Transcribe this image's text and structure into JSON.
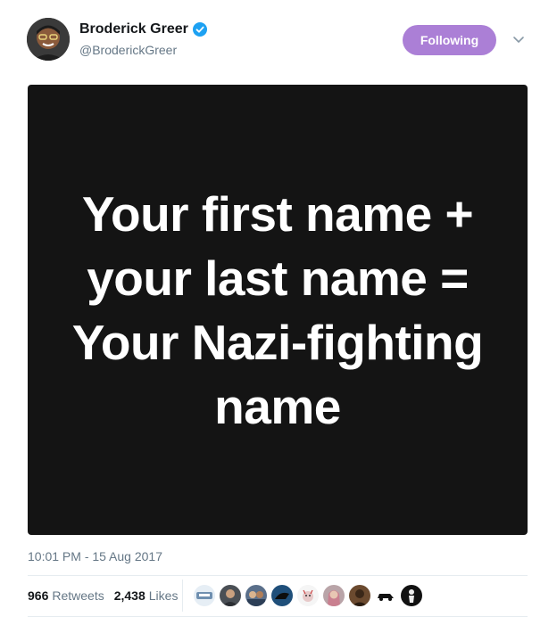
{
  "tweet": {
    "author": {
      "name": "Broderick Greer",
      "handle": "@BroderickGreer",
      "verified": true
    },
    "follow_button_label": "Following",
    "accent_color": "#ab7fd6",
    "media_text": "Your first name + your last name = Your Nazi-fighting name",
    "timestamp": "10:01 PM - 15 Aug 2017",
    "stats": {
      "retweets_count": "966",
      "retweets_label": "Retweets",
      "likes_count": "2,438",
      "likes_label": "Likes"
    },
    "liker_avatar_icons": [
      "badge-avatar",
      "man-avatar",
      "group-avatar",
      "animal-avatar",
      "cartoon-avatar",
      "woman-avatar",
      "dark-avatar",
      "car-avatar",
      "figure-avatar"
    ]
  }
}
